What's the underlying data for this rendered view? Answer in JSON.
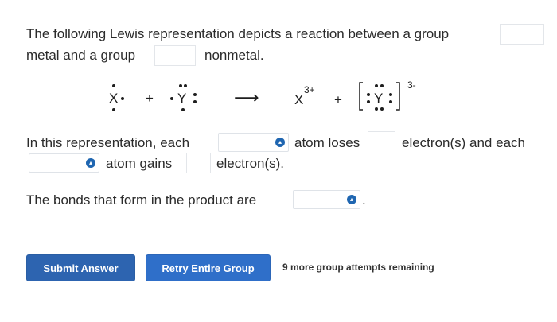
{
  "question": {
    "line1": "The following Lewis representation depicts a reaction between a group",
    "line2_a": "metal and a group",
    "line2_b": "nonmetal."
  },
  "reaction": {
    "reactant1": "X",
    "plus1": "+",
    "reactant2": "Y",
    "arrow": "⟶",
    "product1": "X",
    "product1_charge": "3+",
    "plus2": "+",
    "product2": "Y",
    "product2_charge": "3-"
  },
  "sentence1": {
    "a": "In this representation, each",
    "b": "atom loses",
    "c": "electron(s) and each",
    "d": "atom gains",
    "e": "electron(s)."
  },
  "sentence2": {
    "a": "The bonds that form in the product are",
    "end": "."
  },
  "icons": {
    "select": "dropdown-select-icon"
  },
  "buttons": {
    "submit": "Submit Answer",
    "retry": "Retry Entire Group"
  },
  "attempts": "9 more group attempts remaining",
  "colors": {
    "submit_button": "#2d64b0",
    "retry_button": "#2f6fc9",
    "select_icon": "#1f66b1",
    "text": "#2b2b2b"
  }
}
